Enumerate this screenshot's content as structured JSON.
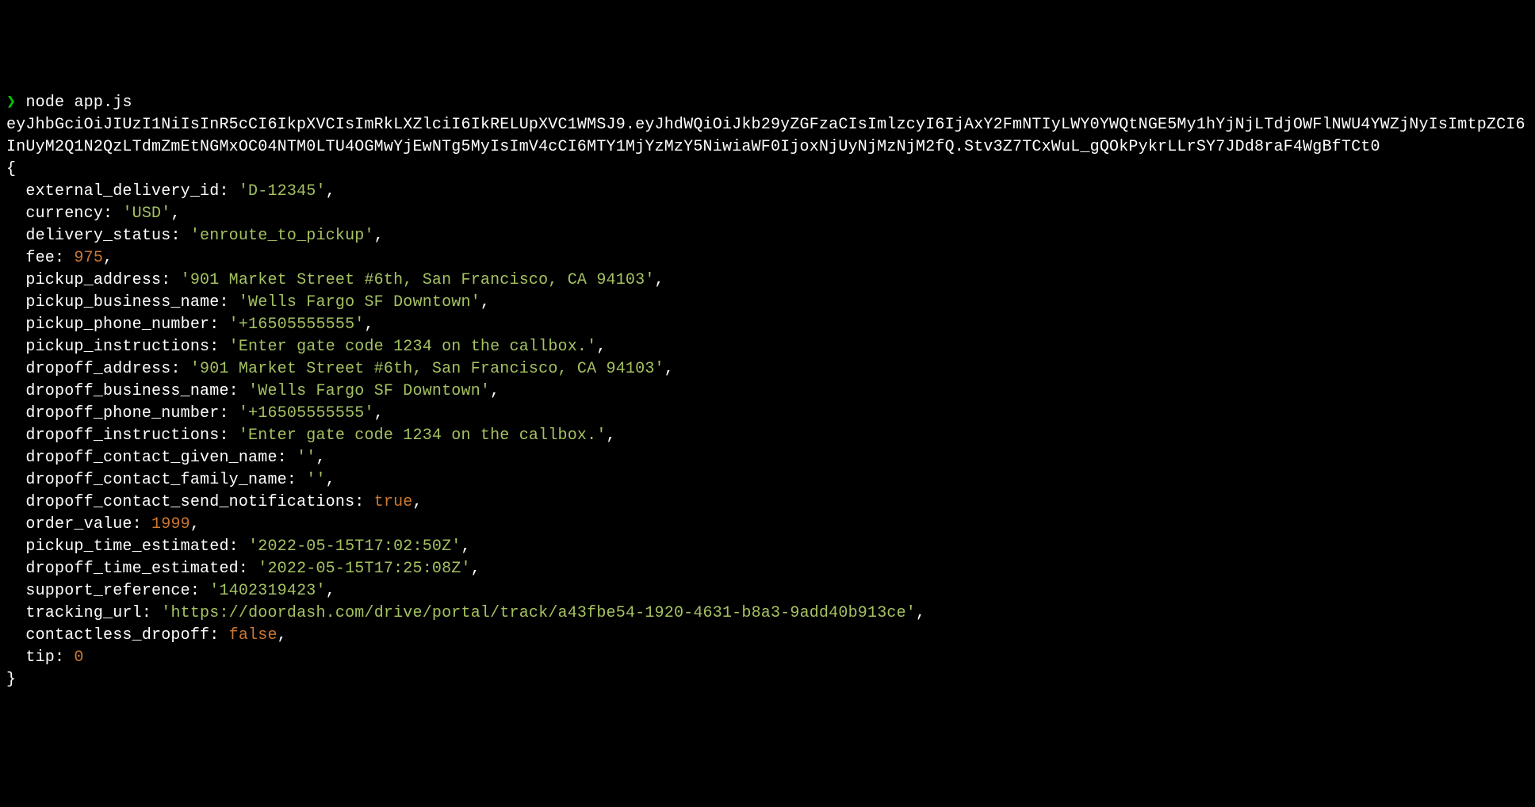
{
  "prompt": "❯",
  "command": "node app.js",
  "jwt_output": "eyJhbGciOiJIUzI1NiIsInR5cCI6IkpXVCIsImRkLXZlciI6IkRELUpXVC1WMSJ9.eyJhdWQiOiJkb29yZGFzaCIsImlzcyI6IjAxY2FmNTIyLWY0YWQtNGE5My1hYjNjLTdjOWFlNWU4YWZjNyIsImtpZCI6InUyM2Q1N2QzLTdmZmEtNGMxOC04NTM0LTU4OGMwYjEwNTg5MyIsImV4cCI6MTY1MjYzMzY5NiwiaWF0IjoxNjUyNjMzNjM2fQ.Stv3Z7TCxWuL_gQOkPykrLLrSY7JDd8raF4WgBfTCt0",
  "obj": {
    "external_delivery_id": {
      "type": "str",
      "value": "'D-12345'"
    },
    "currency": {
      "type": "str",
      "value": "'USD'"
    },
    "delivery_status": {
      "type": "str",
      "value": "'enroute_to_pickup'"
    },
    "fee": {
      "type": "num",
      "value": "975"
    },
    "pickup_address": {
      "type": "str",
      "value": "'901 Market Street #6th, San Francisco, CA 94103'"
    },
    "pickup_business_name": {
      "type": "str",
      "value": "'Wells Fargo SF Downtown'"
    },
    "pickup_phone_number": {
      "type": "str",
      "value": "'+16505555555'"
    },
    "pickup_instructions": {
      "type": "str",
      "value": "'Enter gate code 1234 on the callbox.'"
    },
    "dropoff_address": {
      "type": "str",
      "value": "'901 Market Street #6th, San Francisco, CA 94103'"
    },
    "dropoff_business_name": {
      "type": "str",
      "value": "'Wells Fargo SF Downtown'"
    },
    "dropoff_phone_number": {
      "type": "str",
      "value": "'+16505555555'"
    },
    "dropoff_instructions": {
      "type": "str",
      "value": "'Enter gate code 1234 on the callbox.'"
    },
    "dropoff_contact_given_name": {
      "type": "str",
      "value": "''"
    },
    "dropoff_contact_family_name": {
      "type": "str",
      "value": "''"
    },
    "dropoff_contact_send_notifications": {
      "type": "bool",
      "value": "true"
    },
    "order_value": {
      "type": "num",
      "value": "1999"
    },
    "pickup_time_estimated": {
      "type": "str",
      "value": "'2022-05-15T17:02:50Z'"
    },
    "dropoff_time_estimated": {
      "type": "str",
      "value": "'2022-05-15T17:25:08Z'"
    },
    "support_reference": {
      "type": "str",
      "value": "'1402319423'"
    },
    "tracking_url": {
      "type": "str",
      "value": "'https://doordash.com/drive/portal/track/a43fbe54-1920-4631-b8a3-9add40b913ce'"
    },
    "contactless_dropoff": {
      "type": "bool",
      "value": "false"
    },
    "tip": {
      "type": "num",
      "value": "0"
    }
  },
  "keys_order": [
    "external_delivery_id",
    "currency",
    "delivery_status",
    "fee",
    "pickup_address",
    "pickup_business_name",
    "pickup_phone_number",
    "pickup_instructions",
    "dropoff_address",
    "dropoff_business_name",
    "dropoff_phone_number",
    "dropoff_instructions",
    "dropoff_contact_given_name",
    "dropoff_contact_family_name",
    "dropoff_contact_send_notifications",
    "order_value",
    "pickup_time_estimated",
    "dropoff_time_estimated",
    "support_reference",
    "tracking_url",
    "contactless_dropoff",
    "tip"
  ]
}
